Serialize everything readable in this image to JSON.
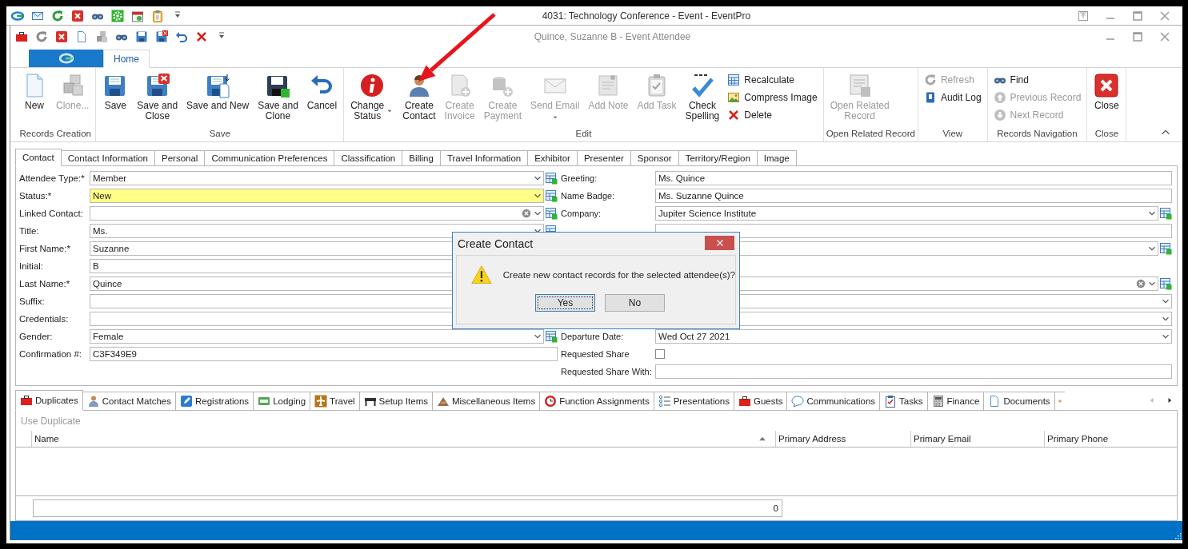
{
  "window": {
    "title": "4031: Technology Conference - Event - EventPro"
  },
  "document_window": {
    "title": "Quince, Suzanne B - Event Attendee"
  },
  "ribbon": {
    "tabs": [
      {
        "label": "Home",
        "selected": true
      }
    ],
    "groups": [
      {
        "label": "Records Creation",
        "buttons": [
          {
            "kind": "large",
            "label": "New",
            "disabled": false
          },
          {
            "kind": "large",
            "label": "Clone...",
            "disabled": true
          }
        ]
      },
      {
        "label": "Save",
        "buttons": [
          {
            "kind": "large",
            "label": "Save",
            "disabled": false
          },
          {
            "kind": "large",
            "label": "Save and\nClose",
            "disabled": false
          },
          {
            "kind": "large",
            "label": "Save and New",
            "disabled": false
          },
          {
            "kind": "large",
            "label": "Save and\nClone",
            "disabled": false
          },
          {
            "kind": "large",
            "label": "Cancel",
            "disabled": false
          }
        ]
      },
      {
        "label": "Edit",
        "buttons": [
          {
            "kind": "large",
            "label": "Change\nStatus",
            "disabled": false,
            "dropdown": true
          },
          {
            "kind": "large",
            "label": "Create\nContact",
            "disabled": false
          },
          {
            "kind": "large",
            "label": "Create\nInvoice",
            "disabled": true
          },
          {
            "kind": "large",
            "label": "Create\nPayment",
            "disabled": true
          },
          {
            "kind": "large",
            "label": "Send Email",
            "disabled": true,
            "dropdown": true
          },
          {
            "kind": "large",
            "label": "Add Note",
            "disabled": true
          },
          {
            "kind": "large",
            "label": "Add Task",
            "disabled": true
          },
          {
            "kind": "large",
            "label": "Check\nSpelling",
            "disabled": false
          },
          {
            "kind": "small",
            "label": "Recalculate",
            "disabled": false
          },
          {
            "kind": "small",
            "label": "Compress Image",
            "disabled": false
          },
          {
            "kind": "small",
            "label": "Delete",
            "disabled": false
          }
        ]
      },
      {
        "label": "Open Related Record",
        "buttons": [
          {
            "kind": "large",
            "label": "Open Related\nRecord",
            "disabled": true
          }
        ]
      },
      {
        "label": "View",
        "buttons": [
          {
            "kind": "small",
            "label": "Refresh",
            "disabled": true
          },
          {
            "kind": "small",
            "label": "Audit Log",
            "disabled": false
          }
        ]
      },
      {
        "label": "Records Navigation",
        "buttons": [
          {
            "kind": "small",
            "label": "Find",
            "disabled": false
          },
          {
            "kind": "small",
            "label": "Previous Record",
            "disabled": true
          },
          {
            "kind": "small",
            "label": "Next Record",
            "disabled": true
          }
        ]
      },
      {
        "label": "Close",
        "buttons": [
          {
            "kind": "large",
            "label": "Close",
            "disabled": false
          }
        ]
      }
    ]
  },
  "form_tabs": [
    {
      "label": "Contact",
      "selected": true
    },
    {
      "label": "Contact Information",
      "selected": false
    },
    {
      "label": "Personal",
      "selected": false
    },
    {
      "label": "Communication Preferences",
      "selected": false
    },
    {
      "label": "Classification",
      "selected": false
    },
    {
      "label": "Billing",
      "selected": false
    },
    {
      "label": "Travel Information",
      "selected": false
    },
    {
      "label": "Exhibitor",
      "selected": false
    },
    {
      "label": "Presenter",
      "selected": false
    },
    {
      "label": "Sponsor",
      "selected": false
    },
    {
      "label": "Territory/Region",
      "selected": false
    },
    {
      "label": "Image",
      "selected": false
    }
  ],
  "form": {
    "left": [
      {
        "label": "Attendee Type:*",
        "value": "Member",
        "kind": "lookup",
        "highlighted": false
      },
      {
        "label": "Status:*",
        "value": "New",
        "kind": "lookup",
        "highlighted": true
      },
      {
        "label": "Linked Contact:",
        "kind": "lookup-clear",
        "highlighted": false
      },
      {
        "label": "Title:",
        "value": "Ms.",
        "kind": "lookup",
        "highlighted": false
      },
      {
        "label": "First Name:*",
        "value": "Suzanne",
        "kind": "text",
        "highlighted": false
      },
      {
        "label": "Initial:",
        "value": "B",
        "kind": "text",
        "highlighted": false
      },
      {
        "label": "Last Name:*",
        "value": "Quince",
        "kind": "text",
        "highlighted": false
      },
      {
        "label": "Suffix:",
        "kind": "text",
        "highlighted": false
      },
      {
        "label": "Credentials:",
        "kind": "text",
        "highlighted": false
      },
      {
        "label": "Gender:",
        "value": "Female",
        "kind": "lookup",
        "highlighted": false
      },
      {
        "label": "Confirmation #:",
        "value": "C3F349E9",
        "kind": "text",
        "highlighted": false
      }
    ],
    "right": [
      {
        "label": "Greeting:",
        "value": "Ms. Quince",
        "kind": "text"
      },
      {
        "label": "Name Badge:",
        "value": "Ms. Suzanne Quince",
        "kind": "text"
      },
      {
        "label": "Company:",
        "value": "Jupiter Science Institute",
        "kind": "lookup"
      },
      {
        "kind": "text"
      },
      {
        "kind": "lookup"
      },
      {
        "kind": "blank"
      },
      {
        "kind": "lookup-clear"
      },
      {
        "kind": "dropdown"
      },
      {
        "kind": "dropdown"
      },
      {
        "label": "Departure Date:",
        "value": "Wed Oct 27 2021",
        "kind": "dropdown"
      },
      {
        "label": "Requested Share",
        "kind": "checkbox",
        "checked": false
      },
      {
        "label": "Requested Share With:",
        "kind": "text"
      }
    ]
  },
  "detail_tabs": [
    {
      "label": "Duplicates",
      "selected": true
    },
    {
      "label": "Contact Matches",
      "selected": false
    },
    {
      "label": "Registrations",
      "selected": false
    },
    {
      "label": "Lodging",
      "selected": false
    },
    {
      "label": "Travel",
      "selected": false
    },
    {
      "label": "Setup Items",
      "selected": false
    },
    {
      "label": "Miscellaneous Items",
      "selected": false
    },
    {
      "label": "Function Assignments",
      "selected": false
    },
    {
      "label": "Presentations",
      "selected": false
    },
    {
      "label": "Guests",
      "selected": false
    },
    {
      "label": "Communications",
      "selected": false
    },
    {
      "label": "Tasks",
      "selected": false
    },
    {
      "label": "Finance",
      "selected": false
    },
    {
      "label": "Documents",
      "selected": false
    },
    {
      "selected": false
    }
  ],
  "detail_panel": {
    "toolbar": [
      {
        "label": "Use Duplicate",
        "disabled": true
      }
    ],
    "columns": [
      {
        "label": "Name",
        "sorted": true
      },
      {
        "label": "Primary Address",
        "sorted": false
      },
      {
        "label": "Primary Email",
        "sorted": false
      },
      {
        "label": "Primary Phone",
        "sorted": false
      }
    ],
    "footer_total": "0"
  },
  "dialog": {
    "title": "Create Contact",
    "message": "Create new contact records for the selected attendee(s)?",
    "buttons": [
      {
        "label": "Yes",
        "default": true
      },
      {
        "label": "No",
        "default": false
      }
    ]
  },
  "annotations": [
    {
      "kind": "arrow"
    }
  ]
}
